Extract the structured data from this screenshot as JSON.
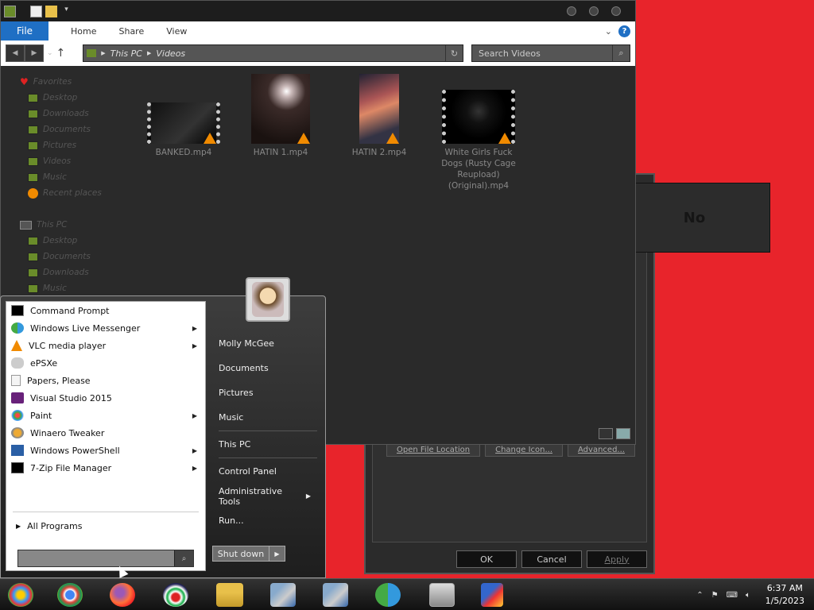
{
  "colors": {
    "desktop": "#e8242b",
    "accent": "#1f6fc4",
    "vlc_orange": "#f08a00"
  },
  "explorer": {
    "ribbon": {
      "file": "File",
      "tabs": [
        "Home",
        "Share",
        "View"
      ]
    },
    "address": {
      "crumbs": [
        "This PC",
        "Videos"
      ]
    },
    "search_placeholder": "Search Videos",
    "nav": {
      "favorites": "Favorites",
      "fav_items": [
        "Desktop",
        "Downloads",
        "Documents",
        "Pictures",
        "Videos",
        "Music",
        "Recent places"
      ],
      "this_pc": "This PC",
      "pc_items": [
        "Desktop",
        "Documents",
        "Downloads",
        "Music"
      ]
    },
    "files": [
      {
        "name": "BANKED.mp4"
      },
      {
        "name": "HATIN 1.mp4"
      },
      {
        "name": "HATIN 2.mp4"
      },
      {
        "name": "White Girls Fuck Dogs (Rusty Cage Reupload) (Original).mp4"
      }
    ]
  },
  "properties_dialog": {
    "buttons_top": [
      "Open File Location",
      "Change Icon...",
      "Advanced..."
    ],
    "ok": "OK",
    "cancel": "Cancel",
    "apply": "Apply"
  },
  "no_box": {
    "label": "No"
  },
  "start_menu": {
    "programs": [
      {
        "label": "Command Prompt",
        "icon": "cmd-icon",
        "submenu": false
      },
      {
        "label": "Windows Live Messenger",
        "icon": "messenger-icon",
        "submenu": true
      },
      {
        "label": "VLC media player",
        "icon": "vlc-icon",
        "submenu": true
      },
      {
        "label": "ePSXe",
        "icon": "gamepad-icon",
        "submenu": false
      },
      {
        "label": "Papers, Please",
        "icon": "document-icon",
        "submenu": false
      },
      {
        "label": "Visual Studio 2015",
        "icon": "visual-studio-icon",
        "submenu": false
      },
      {
        "label": "Paint",
        "icon": "paint-icon",
        "submenu": true
      },
      {
        "label": "Winaero Tweaker",
        "icon": "tweaker-icon",
        "submenu": false
      },
      {
        "label": "Windows PowerShell",
        "icon": "powershell-icon",
        "submenu": true
      },
      {
        "label": "7-Zip File Manager",
        "icon": "7zip-icon",
        "submenu": true
      }
    ],
    "all_programs": "All Programs",
    "places": [
      "Molly McGee",
      "Documents",
      "Pictures",
      "Music",
      "This PC",
      "Control Panel",
      "Administrative Tools",
      "Run..."
    ],
    "shutdown": "Shut down"
  },
  "taskbar": {
    "clock": {
      "time": "6:37 AM",
      "date": "1/5/2023"
    }
  }
}
